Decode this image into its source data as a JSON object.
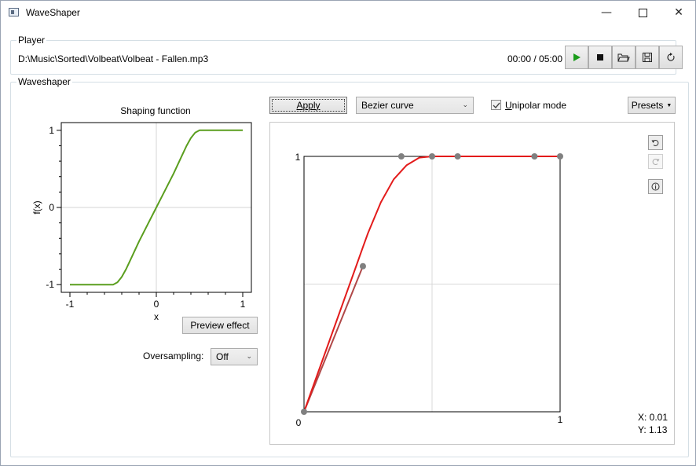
{
  "window": {
    "title": "WaveShaper",
    "minimize_glyph": "—",
    "close_glyph": "✕"
  },
  "player": {
    "group_label": "Player",
    "file_path": "D:\\Music\\Sorted\\Volbeat\\Volbeat - Fallen.mp3",
    "time": "00:00 / 05:00",
    "buttons": [
      "play-icon",
      "stop-icon",
      "open-folder-icon",
      "save-icon",
      "reload-icon"
    ],
    "play_color": "#1a9c1a"
  },
  "waveshaper": {
    "group_label": "Waveshaper",
    "apply_label": "Apply",
    "curve_type": "Bezier curve",
    "unipolar_label_first": "U",
    "unipolar_label_rest": "nipolar mode",
    "unipolar_checked": true,
    "presets_label": "Presets",
    "preview_label": "Preview effect",
    "oversampling_label": "Oversampling:",
    "oversampling_value": "Off",
    "cursor_x": "X: 0.01",
    "cursor_y": "Y: 1.13",
    "tools": [
      "undo-icon",
      "redo-icon",
      "info-icon"
    ]
  },
  "chart_data": [
    {
      "type": "line",
      "title": "Shaping function",
      "xlabel": "x",
      "ylabel": "f(x)",
      "xlim": [
        -1.1,
        1.1
      ],
      "ylim": [
        -1.1,
        1.1
      ],
      "x_ticks": [
        "-1",
        "0",
        "1"
      ],
      "y_ticks": [
        "1",
        "0",
        "-1"
      ],
      "grid": "zero-lines",
      "color": "#5a9e1e",
      "series": [
        {
          "x": [
            -1,
            -0.5,
            -0.45,
            -0.4,
            -0.35,
            -0.3,
            -0.2,
            -0.1,
            0,
            0.1,
            0.2,
            0.3,
            0.35,
            0.4,
            0.45,
            0.5,
            1
          ],
          "y": [
            -1,
            -1,
            -0.97,
            -0.9,
            -0.8,
            -0.68,
            -0.44,
            -0.22,
            0,
            0.22,
            0.44,
            0.68,
            0.8,
            0.9,
            0.97,
            1,
            1
          ]
        }
      ]
    },
    {
      "type": "line",
      "title": "",
      "xlim": [
        0,
        1
      ],
      "ylim": [
        0,
        1
      ],
      "x_ticks": [
        "0",
        "1"
      ],
      "y_ticks": [
        "1"
      ],
      "grid": "midlines",
      "curve_color": "#e31b1b",
      "line_color": "#b04848",
      "control_point_color": "#808080",
      "curve": {
        "x": [
          0,
          0.05,
          0.1,
          0.15,
          0.2,
          0.23,
          0.25,
          0.3,
          0.35,
          0.4,
          0.45,
          0.5,
          1
        ],
        "y": [
          0,
          0.14,
          0.28,
          0.42,
          0.56,
          0.645,
          0.7,
          0.82,
          0.91,
          0.965,
          0.995,
          1,
          1
        ]
      },
      "control_points": {
        "x": [
          0,
          0.23,
          0.38,
          0.5,
          0.6,
          0.9,
          1
        ],
        "y": [
          0,
          0.57,
          1,
          1,
          1,
          1,
          1
        ]
      }
    }
  ]
}
